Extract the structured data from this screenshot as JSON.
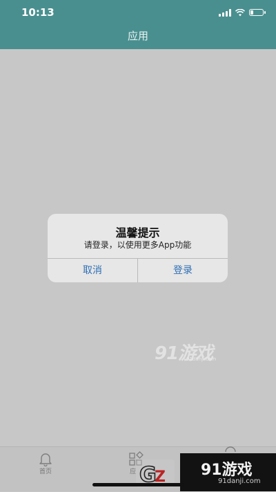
{
  "status_bar": {
    "time": "10:13",
    "battery_level": 0.25
  },
  "header": {
    "title": "应用"
  },
  "alert": {
    "title": "温馨提示",
    "message": "请登录，以使用更多App功能",
    "cancel_label": "取消",
    "login_label": "登录"
  },
  "tab_bar": {
    "items": [
      {
        "label": "首页",
        "icon": "bell-icon"
      },
      {
        "label": "应",
        "icon": "apps-icon"
      },
      {
        "label": "",
        "icon": "profile-icon"
      }
    ]
  },
  "watermark": {
    "main": "91游戏",
    "sub": "91danji.com"
  },
  "brand_overlay": {
    "main": "91游戏",
    "sub": "91danji.com"
  },
  "colors": {
    "header": "#4a8f8f",
    "background": "#c7c7c7",
    "alert_bg": "#e7e7e7",
    "button_text": "#2f6fb5"
  }
}
